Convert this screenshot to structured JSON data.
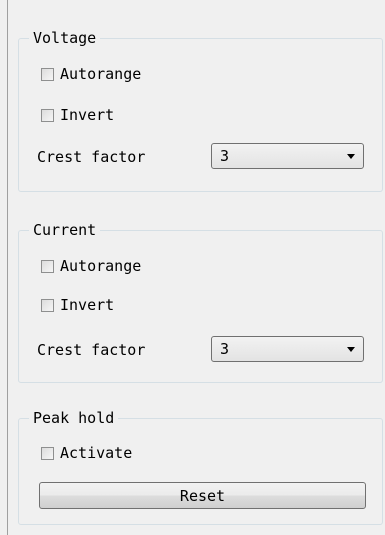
{
  "voltage": {
    "title": "Voltage",
    "autorange_label": "Autorange",
    "invert_label": "Invert",
    "crest_label": "Crest factor",
    "crest_value": "3"
  },
  "current": {
    "title": "Current",
    "autorange_label": "Autorange",
    "invert_label": "Invert",
    "crest_label": "Crest factor",
    "crest_value": "3"
  },
  "peak_hold": {
    "title": "Peak hold",
    "activate_label": "Activate",
    "reset_label": "Reset"
  }
}
